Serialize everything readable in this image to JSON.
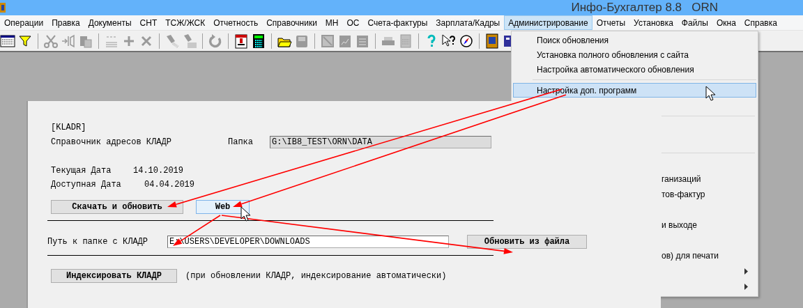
{
  "window": {
    "title": "Инфо-Бухгалтер 8.8   ORN"
  },
  "menu_bar": [
    {
      "label": "Операции",
      "selected": false
    },
    {
      "label": "Правка",
      "selected": false
    },
    {
      "label": "Документы",
      "selected": false
    },
    {
      "label": "СНТ",
      "selected": false
    },
    {
      "label": "ТСЖ/ЖСК",
      "selected": false
    },
    {
      "label": "Отчетность",
      "selected": false
    },
    {
      "label": "Справочники",
      "selected": false
    },
    {
      "label": "МН",
      "selected": false
    },
    {
      "label": "ОС",
      "selected": false
    },
    {
      "label": "Счета-фактуры",
      "selected": false
    },
    {
      "label": "Зарплата/Кадры",
      "selected": false
    },
    {
      "label": "Администрирование",
      "selected": true
    },
    {
      "label": "Отчеты",
      "selected": false
    },
    {
      "label": "Установка",
      "selected": false
    },
    {
      "label": "Файлы",
      "selected": false
    },
    {
      "label": "Окна",
      "selected": false
    },
    {
      "label": "Справка",
      "selected": false
    }
  ],
  "dropdown": {
    "items": [
      {
        "kind": "item",
        "label": "Поиск обновления",
        "selected": false
      },
      {
        "kind": "item",
        "label": "Установка полного обновления с сайта",
        "selected": false
      },
      {
        "kind": "item",
        "label": "Настройка автоматического обновления",
        "selected": false
      },
      {
        "kind": "separator"
      },
      {
        "kind": "item",
        "label": "Настройка доп. программ",
        "selected": true
      }
    ],
    "partly_covered_items": [
      {
        "kind": "covered"
      },
      {
        "kind": "separator"
      },
      {
        "kind": "covered"
      },
      {
        "kind": "covered"
      },
      {
        "kind": "separator"
      },
      {
        "kind": "covered"
      },
      {
        "kind": "item",
        "label": "ганизаций"
      },
      {
        "kind": "item",
        "label": "тов-фактур"
      },
      {
        "kind": "covered"
      },
      {
        "kind": "item",
        "label": "и выходе"
      },
      {
        "kind": "covered"
      },
      {
        "kind": "item",
        "label": "ов) для печати"
      },
      {
        "kind": "submenu"
      },
      {
        "kind": "submenu"
      }
    ]
  },
  "dialog": {
    "section": "[KLADR]",
    "directory_label": "Справочник адресов КЛАДР",
    "folder_label": "Папка",
    "folder_value": "G:\\IB8_TEST\\ORN\\DATA",
    "folder_disabled": true,
    "current_date_label": "Текущая Дата",
    "current_date": "14.10.2019",
    "available_date_label": "Доступная Дата",
    "available_date": "04.04.2019",
    "buttons": [
      {
        "label": "Скачать и обновить",
        "hovered": false
      },
      {
        "label": "Web",
        "hovered": true
      }
    ],
    "path_label": "Путь к папке с КЛАДР",
    "path_value": "E:\\USERS\\DEVELOPER\\DOWNLOADS",
    "path_disabled": false,
    "update_button": "Обновить из файла",
    "index_button": "Индексировать КЛАДР",
    "index_note": "(при обновлении КЛАДР, индексирование автоматически)"
  }
}
